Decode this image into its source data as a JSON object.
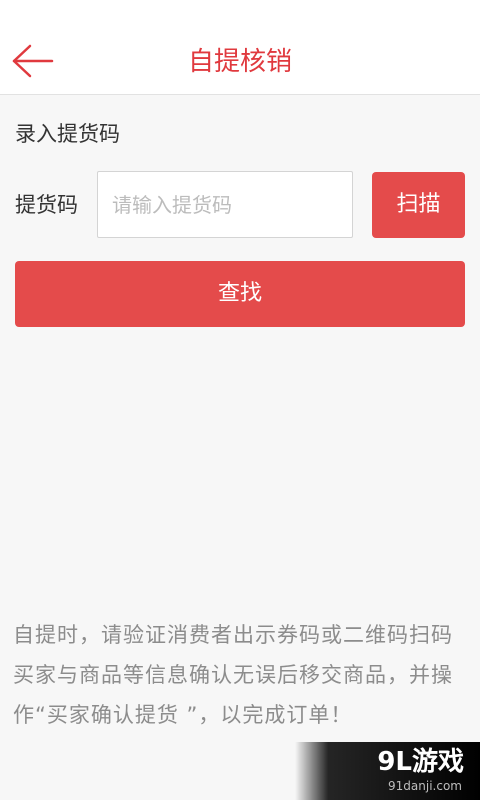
{
  "header": {
    "title": "自提核销",
    "back_icon": "arrow-left-icon",
    "accent_color": "#e0393e"
  },
  "form": {
    "section_label": "录入提货码",
    "code_label": "提货码",
    "code_input_value": "",
    "code_input_placeholder": "请输入提货码",
    "scan_label": "扫描",
    "search_label": "查找",
    "button_color": "#e44b4b"
  },
  "notice": {
    "text": "自提时，请验证消费者出示券码或二维码扫码买家与商品等信息确认无误后移交商品，并操作“买家确认提货 ”，以完成订单！"
  },
  "watermark": {
    "logo": "9L游戏",
    "url": "91danji.com"
  }
}
